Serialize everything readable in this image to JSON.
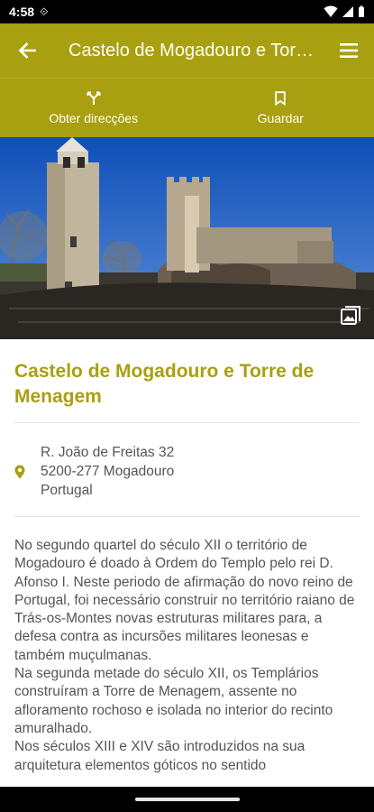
{
  "status_bar": {
    "time": "4:58",
    "sync_icon": "sync-icon",
    "wifi_icon": "wifi-icon",
    "signal_icon": "signal-icon",
    "battery_icon": "battery-icon"
  },
  "app_bar": {
    "title": "Castelo de Mogadouro e Torre de Menagem",
    "back_icon": "arrow-back-icon",
    "menu_icon": "menu-icon"
  },
  "actions": {
    "directions_label": "Obter direcções",
    "save_label": "Guardar"
  },
  "hero": {
    "description": "Photo of Castelo de Mogadouro with tower against blue sky",
    "gallery_icon": "image-gallery-icon"
  },
  "place": {
    "title": "Castelo de Mogadouro e Torre de Menagem",
    "address": {
      "line1": "R. João de Freitas 32",
      "line2": "5200-277 Mogadouro",
      "line3": "Portugal"
    },
    "description": "No segundo quartel do século XII o território de Mogadouro é doado à Ordem do Templo pelo rei D. Afonso I. Neste periodo de afirmação do novo reino de Portugal, foi necessário construir no território raiano de Trás-os-Montes novas estruturas militares para, a defesa contra as incursões militares leonesas e também muçulmanas.\nNa segunda metade do século XII, os Templários construíram a Torre de Menagem, assente no afloramento rochoso e isolada no interior do recinto amuralhado.\nNos séculos XIII e XIV são introduzidos na sua arquitetura elementos góticos no sentido"
  },
  "colors": {
    "primary": "#a8a010",
    "text": "#555555"
  }
}
